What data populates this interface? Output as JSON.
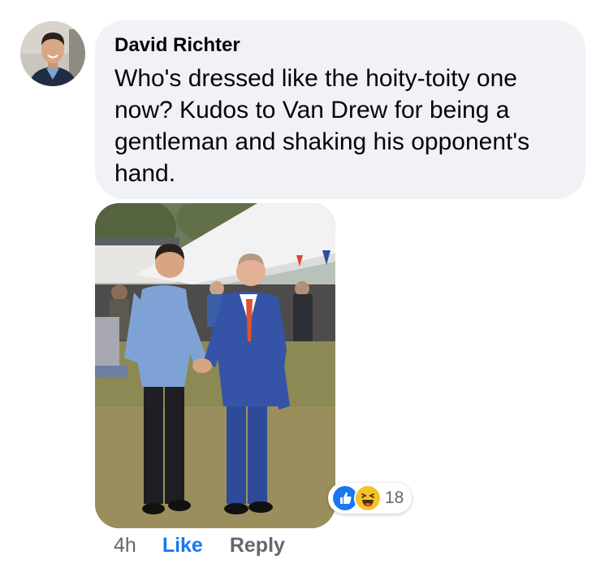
{
  "comment": {
    "author": "David Richter",
    "text": "Who's dressed like the hoity-toity one now?  Kudos to Van Drew for being a gentleman and shaking his opponent's hand.",
    "time": "4h",
    "like_label": "Like",
    "reply_label": "Reply"
  },
  "reactions": {
    "icons": [
      "like-icon",
      "haha-icon"
    ],
    "count": "18"
  },
  "colors": {
    "bubble_bg": "#f0f2f5",
    "like_blue": "#1877f2",
    "secondary_text": "#65676b"
  }
}
